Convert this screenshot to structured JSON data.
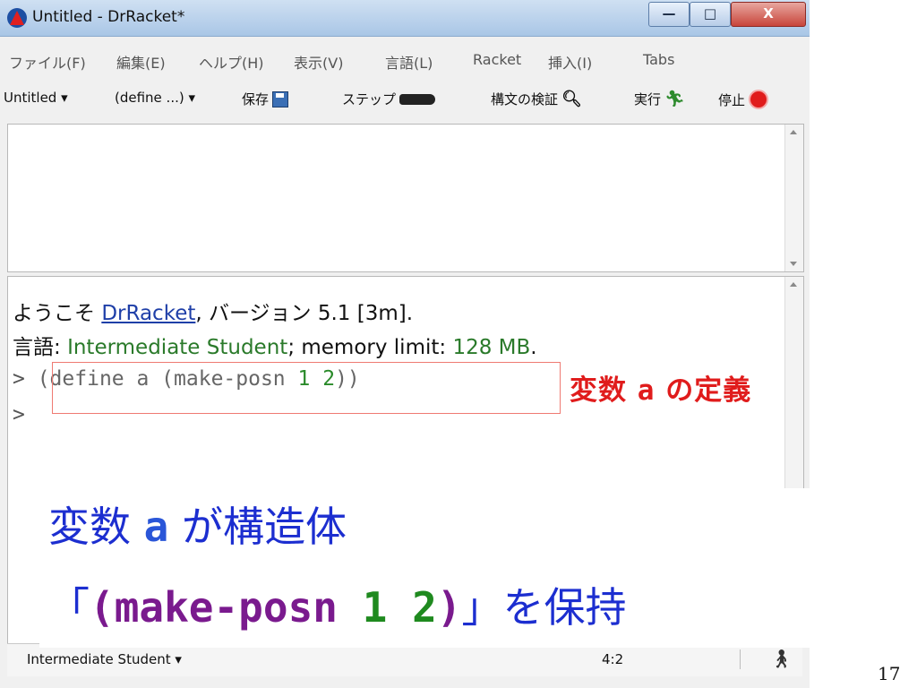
{
  "window": {
    "title": "Untitled - DrRacket*",
    "controls": {
      "minimize": "—",
      "maximize": "□",
      "close": "X"
    }
  },
  "menubar": {
    "items": [
      {
        "label": "ファイル(F)"
      },
      {
        "label": "編集(E)"
      },
      {
        "label": "ヘルプ(H)"
      },
      {
        "label": "表示(V)"
      },
      {
        "label": "言語(L)"
      },
      {
        "label": "Racket"
      },
      {
        "label": "挿入(I)"
      },
      {
        "label": "Tabs"
      }
    ]
  },
  "toolbar": {
    "file_menu": "Untitled ▾",
    "define_menu": "(define ...) ▾",
    "save_label": "保存",
    "step_label": "ステップ",
    "check_syntax_label": "構文の検証",
    "run_label": "実行",
    "stop_label": "停止"
  },
  "interactions": {
    "welcome_prefix": "ようこそ ",
    "welcome_link": "DrRacket",
    "welcome_suffix": ", バージョン 5.1 [3m].",
    "lang_prefix": "言語: ",
    "lang_value": "Intermediate Student",
    "lang_mid": "; memory limit: ",
    "mem_value": "128 MB",
    "lang_end": ".",
    "prompt1": ">",
    "code_before_nums": " (define a (make-posn ",
    "code_num1": "1",
    "code_num_space": " ",
    "code_num2": "2",
    "code_after_nums": "))",
    "prompt2": ">"
  },
  "annotation": {
    "prefix": "変数 ",
    "var": "a",
    "suffix": " の定義"
  },
  "overlay": {
    "line1_prefix": "変数 ",
    "line1_var": "a",
    "line1_suffix": " が構造体",
    "line2_open": "「",
    "line2_code_paren_open": "(",
    "line2_code_fn": "make-posn ",
    "line2_num1": "1",
    "line2_num_space": " ",
    "line2_num2": "2",
    "line2_code_paren_close": ")",
    "line2_close": "」を保持"
  },
  "statusbar": {
    "language": "Intermediate Student ▾",
    "position": "4:2"
  },
  "page_number": "17",
  "colors": {
    "annotation": "#e01c1c",
    "overlay_text": "#1c2ed0",
    "code_purple": "#7a1a8e",
    "code_green": "#1f8a1f"
  }
}
